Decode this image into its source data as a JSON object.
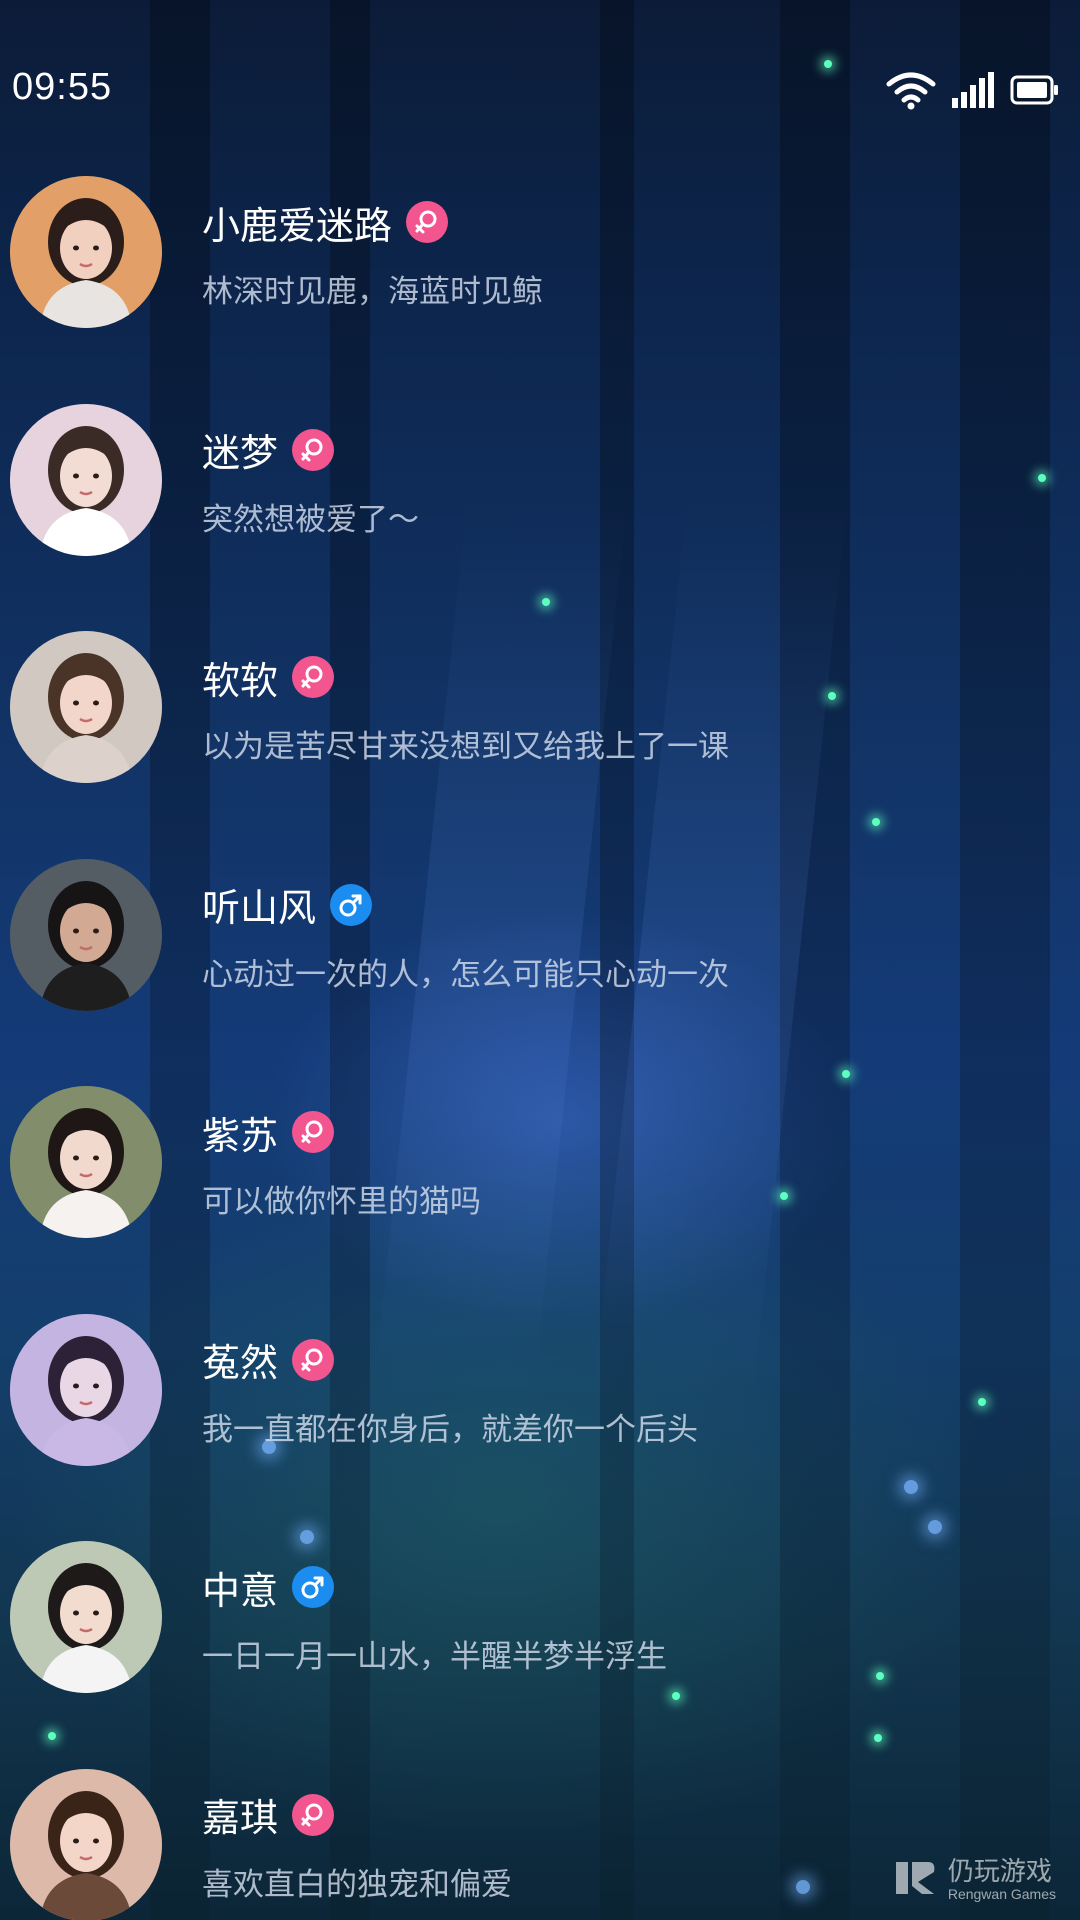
{
  "status_bar": {
    "time": "09:55",
    "icons": [
      "wifi-icon",
      "cellular-signal-icon",
      "battery-icon"
    ]
  },
  "colors": {
    "female_badge": "#f3558f",
    "male_badge": "#1c8df0",
    "name_text": "#ffffff",
    "bio_text": "#d2dceb"
  },
  "contacts": [
    {
      "name": "小鹿爱迷路",
      "gender": "female",
      "bio": "林深时见鹿，海蓝时见鲸"
    },
    {
      "name": "迷梦",
      "gender": "female",
      "bio": "突然想被爱了～"
    },
    {
      "name": "软软",
      "gender": "female",
      "bio": "以为是苦尽甘来没想到又给我上了一课"
    },
    {
      "name": "听山风",
      "gender": "male",
      "bio": "心动过一次的人，怎么可能只心动一次"
    },
    {
      "name": "紫苏",
      "gender": "female",
      "bio": "可以做你怀里的猫吗"
    },
    {
      "name": "菟然",
      "gender": "female",
      "bio": "我一直都在你身后，就差你一个后头"
    },
    {
      "name": "中意",
      "gender": "male",
      "bio": "一日一月一山水，半醒半梦半浮生"
    },
    {
      "name": "嘉琪",
      "gender": "female",
      "bio": "喜欢直白的独宠和偏爱"
    }
  ],
  "watermark": {
    "name_cn": "仍玩游戏",
    "name_en": "Rengwan Games"
  }
}
